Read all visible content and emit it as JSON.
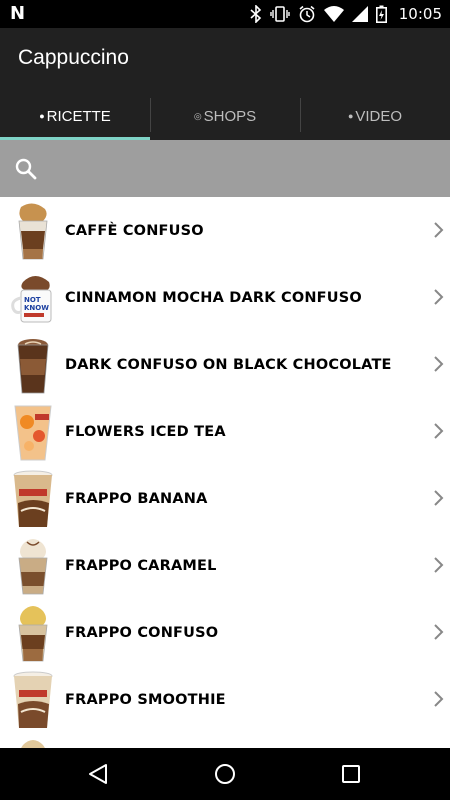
{
  "status_bar": {
    "time": "10:05"
  },
  "app": {
    "title": "Cappuccino"
  },
  "tabs": [
    {
      "label": "RICETTE",
      "active": true
    },
    {
      "label": "SHOPS",
      "active": false
    },
    {
      "label": "VIDEO",
      "active": false
    }
  ],
  "search": {
    "placeholder": ""
  },
  "recipes": [
    {
      "name": "CAFFÈ CONFUSO",
      "thumb": "glass-cup-with-whipped-cream"
    },
    {
      "name": "CINNAMON MOCHA DARK CONFUSO",
      "thumb": "white-mug-with-whipped-cream"
    },
    {
      "name": "DARK CONFUSO ON BLACK CHOCOLATE",
      "thumb": "glass-cup-with-latte-art"
    },
    {
      "name": "FLOWERS ICED TEA",
      "thumb": "plastic-cup-iced-tea"
    },
    {
      "name": "FRAPPO BANANA",
      "thumb": "plastic-cup-frappo"
    },
    {
      "name": "FRAPPO CARAMEL",
      "thumb": "glass-cup-with-whipped-cream"
    },
    {
      "name": "FRAPPO CONFUSO",
      "thumb": "glass-cup-with-whipped-cream"
    },
    {
      "name": "FRAPPO SMOOTHIE",
      "thumb": "plastic-cup-frappo"
    },
    {
      "name": "",
      "thumb": "glass-cup-with-whipped-cream"
    }
  ],
  "colors": {
    "tab_indicator": "#7fd3c6",
    "app_bar": "#212121",
    "search_bar": "#9e9e9e"
  }
}
